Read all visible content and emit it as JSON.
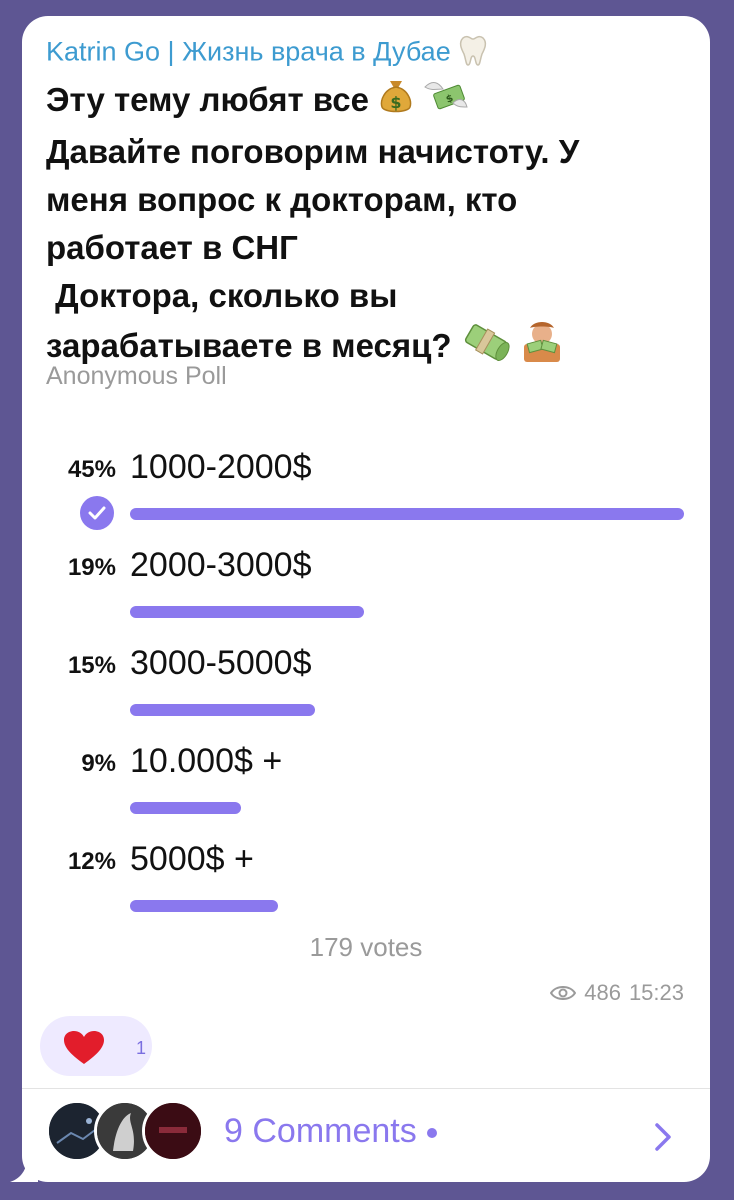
{
  "post": {
    "channel": "Katrin Go | Жизнь врача в Дубае",
    "lines": [
      "Эту тему любят все",
      "Давайте поговорим начистоту. У",
      "меня вопрос к докторам, кто",
      "работает в СНГ",
      " Доктора, сколько вы",
      "зарабатываете в месяц?"
    ],
    "icons": [
      "tooth-emoji",
      "money-bag-emoji",
      "money-wings-emoji",
      "money-roll-emoji",
      "money-hands-emoji"
    ]
  },
  "poll": {
    "type": "Anonymous Poll",
    "options": [
      {
        "percent_label": "45%",
        "label": "1000-2000$",
        "share": 0.45,
        "chosen": true
      },
      {
        "percent_label": "19%",
        "label": "2000-3000$",
        "share": 0.19,
        "chosen": false
      },
      {
        "percent_label": "15%",
        "label": "3000-5000$",
        "share": 0.15,
        "chosen": false
      },
      {
        "percent_label": "9%",
        "label": "10.000$ +",
        "share": 0.09,
        "chosen": false
      },
      {
        "percent_label": "12%",
        "label": "5000$ +",
        "share": 0.12,
        "chosen": false
      }
    ],
    "votes": "179 votes"
  },
  "meta": {
    "views": "486",
    "time": "15:23",
    "icon": "eye-icon"
  },
  "reaction": {
    "icon": "heart-icon",
    "count": "1"
  },
  "comments": {
    "label": "9 Comments",
    "icon": "chevron-right-icon"
  },
  "colors": {
    "accent": "#8a78ee",
    "background": "#5e5693",
    "channel_name": "#3d9bd0"
  }
}
